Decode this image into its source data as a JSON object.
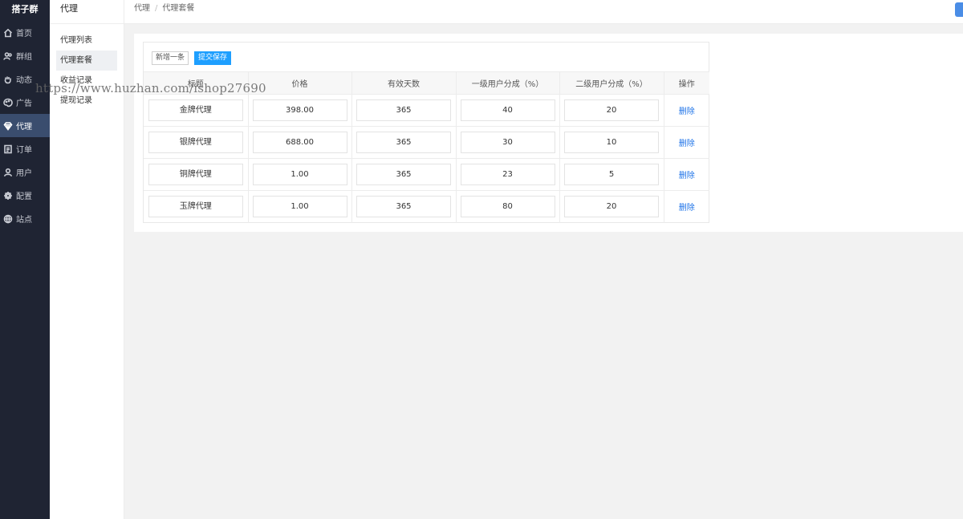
{
  "sidebar": {
    "brand": "搭子群",
    "items": [
      {
        "label": "首页",
        "icon": "home-icon"
      },
      {
        "label": "群组",
        "icon": "group-icon"
      },
      {
        "label": "动态",
        "icon": "hand-icon"
      },
      {
        "label": "广告",
        "icon": "palette-icon"
      },
      {
        "label": "代理",
        "icon": "diamond-icon",
        "active": true
      },
      {
        "label": "订单",
        "icon": "document-icon"
      },
      {
        "label": "用户",
        "icon": "user-icon"
      },
      {
        "label": "配置",
        "icon": "gear-icon"
      },
      {
        "label": "站点",
        "icon": "globe-icon"
      }
    ]
  },
  "submenu": {
    "title": "代理",
    "items": [
      "代理列表",
      "代理套餐",
      "收益记录",
      "提现记录"
    ],
    "active_index": 1
  },
  "breadcrumb": {
    "parent": "代理",
    "current": "代理套餐"
  },
  "toolbar": {
    "add_label": "新增一条",
    "save_label": "提交保存"
  },
  "table": {
    "columns": [
      "标题",
      "价格",
      "有效天数",
      "一级用户分成（%）",
      "二级用户分成（%）",
      "操作"
    ],
    "rows": [
      {
        "title": "金牌代理",
        "price": "398.00",
        "days": "365",
        "level1": "40",
        "level2": "20"
      },
      {
        "title": "银牌代理",
        "price": "688.00",
        "days": "365",
        "level1": "30",
        "level2": "10"
      },
      {
        "title": "铜牌代理",
        "price": "1.00",
        "days": "365",
        "level1": "23",
        "level2": "5"
      },
      {
        "title": "玉牌代理",
        "price": "1.00",
        "days": "365",
        "level1": "80",
        "level2": "20"
      }
    ],
    "delete_label": "删除"
  },
  "watermark": "https://www.huzhan.com/ishop27690",
  "colors": {
    "sidebar_bg": "#1f2433",
    "primary": "#1e9fff",
    "link": "#1e73e8"
  }
}
